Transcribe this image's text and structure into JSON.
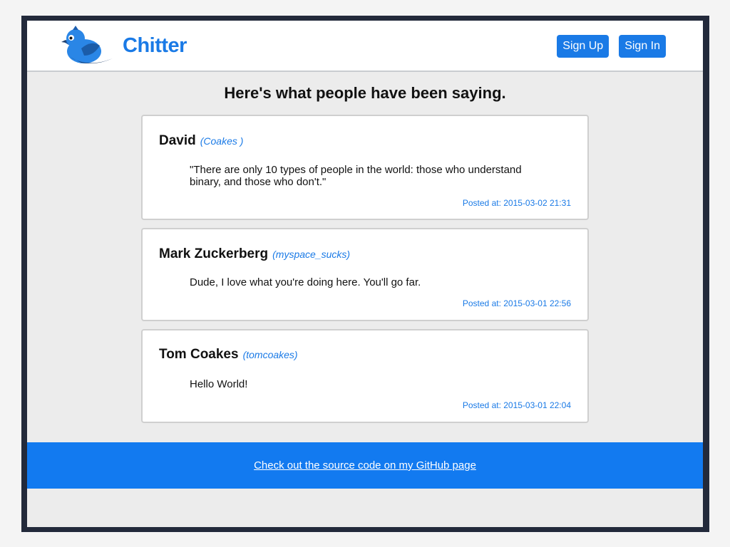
{
  "header": {
    "brand": "Chitter",
    "logo_icon": "bird-icon",
    "nav": {
      "sign_up": "Sign Up",
      "sign_in": "Sign In"
    }
  },
  "main": {
    "title": "Here's what people have been saying.",
    "peeps": [
      {
        "name": "David",
        "handle": "(Coakes )",
        "message": "\"There are only 10 types of people in the world: those who understand binary, and those who don't.\"",
        "posted": "Posted at: 2015-03-02 21:31"
      },
      {
        "name": "Mark Zuckerberg",
        "handle": "(myspace_sucks)",
        "message": "Dude, I love what you're doing here. You'll go far.",
        "posted": "Posted at: 2015-03-01 22:56"
      },
      {
        "name": "Tom Coakes",
        "handle": "(tomcoakes)",
        "message": "Hello World!",
        "posted": "Posted at: 2015-03-01 22:04"
      }
    ]
  },
  "footer": {
    "link": "Check out the source code on my GitHub page"
  },
  "colors": {
    "accent": "#1a7ae6",
    "footer": "#127af0",
    "frame": "#232a3b"
  }
}
